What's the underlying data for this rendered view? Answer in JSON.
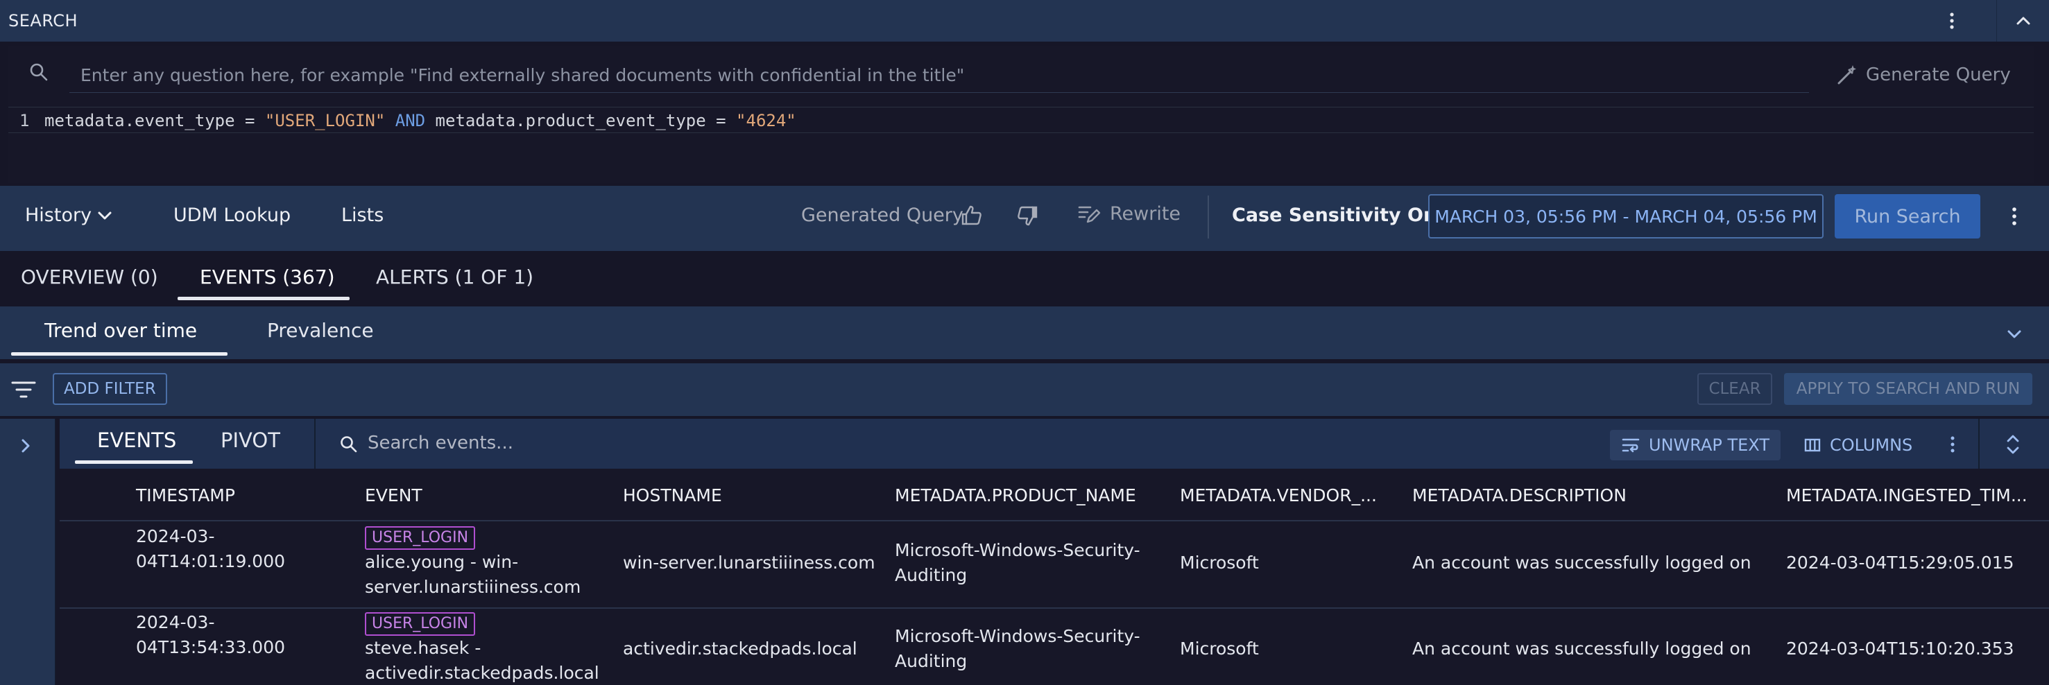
{
  "search_header": {
    "title": "SEARCH"
  },
  "nlq": {
    "placeholder": "Enter any question here, for example \"Find externally shared documents with confidential in the title\"",
    "generate_label": "Generate Query"
  },
  "query": {
    "line_number": "1",
    "field1": "metadata.event_type",
    "op1": " = ",
    "value1": "\"USER_LOGIN\"",
    "keyword": " AND ",
    "field2": "metadata.product_event_type",
    "op2": " = ",
    "value2": "\"4624\""
  },
  "toolbar": {
    "history_label": "History",
    "udm_lookup_label": "UDM Lookup",
    "lists_label": "Lists",
    "generated_query_label": "Generated Query",
    "rewrite_label": "Rewrite",
    "case_sensitivity_label": "Case Sensitivity On",
    "date_range": "MARCH 03, 05:56 PM - MARCH 04, 05:56 PM",
    "run_search_label": "Run Search"
  },
  "tabs": {
    "overview": "OVERVIEW (0)",
    "events": "EVENTS (367)",
    "alerts": "ALERTS (1 OF 1)"
  },
  "subtabs": {
    "trend": "Trend over time",
    "prevalence": "Prevalence"
  },
  "filter_bar": {
    "add_filter_label": "ADD FILTER",
    "clear_label": "CLEAR",
    "apply_label": "APPLY TO SEARCH AND RUN"
  },
  "results_toolbar": {
    "events_tab": "EVENTS",
    "pivot_tab": "PIVOT",
    "search_placeholder": "Search events...",
    "unwrap_label": "UNWRAP TEXT",
    "columns_label": "COLUMNS"
  },
  "table": {
    "columns": [
      "TIMESTAMP",
      "EVENT",
      "HOSTNAME",
      "METADATA.PRODUCT_NAME",
      "METADATA.VENDOR_...",
      "METADATA.DESCRIPTION",
      "METADATA.INGESTED_TIM..."
    ],
    "rows": [
      {
        "timestamp_line1": "2024-03-",
        "timestamp_line2": "04T14:01:19.000",
        "event_badge": "USER_LOGIN",
        "event_line1": "alice.young - win-",
        "event_line2": "server.lunarstiiiness.com",
        "hostname": "win-server.lunarstiiiness.com",
        "product_line1": "Microsoft-Windows-Security-",
        "product_line2": "Auditing",
        "vendor": "Microsoft",
        "description": "An account was successfully logged on",
        "ingested": "2024-03-04T15:29:05.015"
      },
      {
        "timestamp_line1": "2024-03-",
        "timestamp_line2": "04T13:54:33.000",
        "event_badge": "USER_LOGIN",
        "event_line1": "steve.hasek -",
        "event_line2": "activedir.stackedpads.local",
        "hostname": "activedir.stackedpads.local",
        "product_line1": "Microsoft-Windows-Security-",
        "product_line2": "Auditing",
        "vendor": "Microsoft",
        "description": "An account was successfully logged on",
        "ingested": "2024-03-04T15:10:20.353"
      }
    ]
  },
  "colors": {
    "header_bg": "#233452",
    "page_bg": "#161627",
    "accent_blue": "#2d5fae",
    "badge_purple": "#b04fd0"
  }
}
